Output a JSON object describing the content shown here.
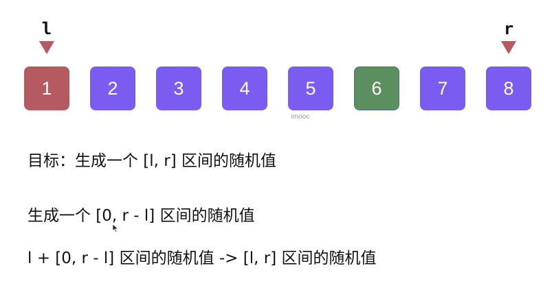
{
  "pointers": {
    "left": {
      "label": "l",
      "color": "#b45a60"
    },
    "right": {
      "label": "r",
      "color": "#b45a60"
    }
  },
  "cells": [
    {
      "value": "1",
      "color": "#b45a60",
      "state": "left-pointer"
    },
    {
      "value": "2",
      "color": "#7b5cf0",
      "state": "normal"
    },
    {
      "value": "3",
      "color": "#7b5cf0",
      "state": "normal"
    },
    {
      "value": "4",
      "color": "#7b5cf0",
      "state": "normal"
    },
    {
      "value": "5",
      "color": "#7b5cf0",
      "state": "normal"
    },
    {
      "value": "6",
      "color": "#5b8f5f",
      "state": "highlighted"
    },
    {
      "value": "7",
      "color": "#7b5cf0",
      "state": "normal"
    },
    {
      "value": "8",
      "color": "#7b5cf0",
      "state": "right-pointer"
    }
  ],
  "watermark": "imooc",
  "text_lines": [
    "目标：生成一个 [l, r] 区间的随机值",
    "生成一个 [0, r - l] 区间的随机值",
    "l + [0, r - l] 区间的随机值 -> [l, r] 区间的随机值"
  ]
}
